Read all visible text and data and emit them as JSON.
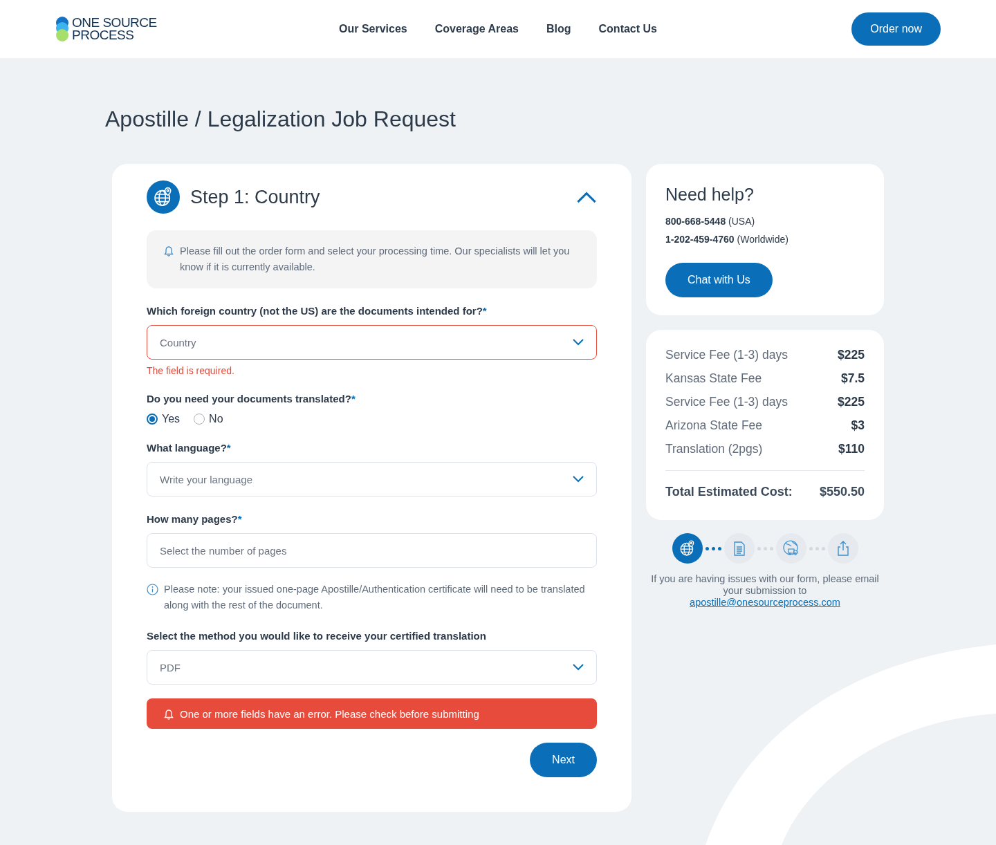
{
  "header": {
    "logo_lines": [
      "ONE SOURCE",
      "PROCESS"
    ],
    "nav": [
      "Our Services",
      "Coverage Areas",
      "Blog",
      "Contact Us"
    ],
    "cta": "Order now"
  },
  "page_title": "Apostille / Legalization Job Request",
  "step": {
    "title": "Step 1: Country",
    "expanded": true,
    "notice": "Please fill out the order form and select your processing time. Our specialists will let you know if it is currently available.",
    "fields": [
      {
        "kind": "select",
        "label": "Which foreign country (not the US) are the documents intended for?",
        "mark": "*",
        "placeholder": "Country",
        "error": "The field is required."
      },
      {
        "kind": "radio",
        "label": "Do you need your documents translated?",
        "mark": "*",
        "options": [
          {
            "label": "Yes",
            "selected": true
          },
          {
            "label": "No",
            "selected": false
          }
        ]
      },
      {
        "kind": "select",
        "label": "What language?",
        "mark": "*",
        "placeholder": "Write your language"
      },
      {
        "kind": "input",
        "label": "How many pages?",
        "mark": "*",
        "placeholder": "Select the number of pages"
      },
      {
        "kind": "info",
        "text": "Please note: your issued one-page Apostille/Authentication certificate will need to be translated along with the rest of the document."
      },
      {
        "kind": "select",
        "label": "Select the method you would like to receive your certified translation",
        "value": "PDF"
      }
    ],
    "alert": "One or more fields have an error. Please check before submitting",
    "next": "Next"
  },
  "help": {
    "title": "Need help?",
    "phones": [
      {
        "number": "800-668-5448",
        "region": "(USA)"
      },
      {
        "number": "1-202-459-4760",
        "region": "(Worldwide)"
      }
    ],
    "chat": "Chat with Us"
  },
  "costs": {
    "items": [
      {
        "label": "Service Fee (1-3) days",
        "amount": "$225"
      },
      {
        "label": "Kansas State Fee",
        "amount": "$7.5"
      },
      {
        "label": "Service Fee (1-3) days",
        "amount": "$225"
      },
      {
        "label": "Arizona State Fee",
        "amount": "$3"
      },
      {
        "label": "Translation (2pgs)",
        "amount": "$110"
      }
    ],
    "total_label": "Total Estimated Cost:",
    "total": "$550.50"
  },
  "progress": [
    {
      "kind": "globe",
      "selected": true
    },
    {
      "kind": "document",
      "selected": false
    },
    {
      "kind": "delivery",
      "selected": false
    },
    {
      "kind": "upload",
      "selected": false
    }
  ],
  "footer_note": {
    "text": "If you are having issues with our form, please email your submission to",
    "email": "apostille@onesourceprocess.com"
  }
}
